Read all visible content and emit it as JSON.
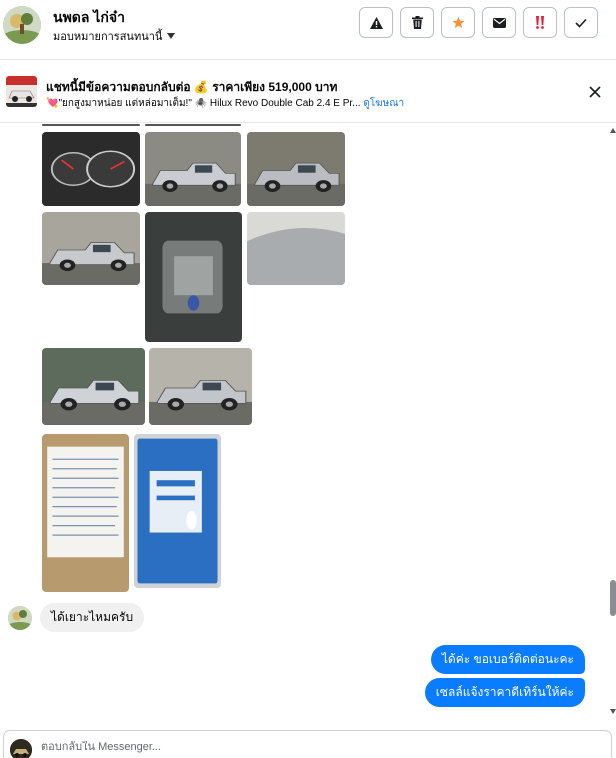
{
  "header": {
    "contact_name": "นพดล ไก่จ๋า",
    "assign_label": "มอบหมายการสนทนานี้",
    "actions": [
      {
        "name": "report-spam-button",
        "icon": "warning-icon"
      },
      {
        "name": "delete-button",
        "icon": "trash-icon"
      },
      {
        "name": "follow-up-button",
        "icon": "star-icon"
      },
      {
        "name": "mark-unread-button",
        "icon": "envelope-icon"
      },
      {
        "name": "priority-button",
        "icon": "double-exclamation-icon"
      },
      {
        "name": "mark-done-button",
        "icon": "checkmark-icon"
      }
    ],
    "colors": {
      "star": "#f7923b",
      "priority": "#e41e3f"
    }
  },
  "ad_banner": {
    "title": "แชทนี้มีข้อความตอบกลับต่อ 💰 ราคาเพียง 519,000 บาท",
    "subtitle": "💘\"ยกสูงมาหน่อย แต่หล่อมาเต็ม!\" 🕷️ Hilux Revo Double Cab 2.4 E Pr...",
    "view_ad_link": "ดูโฆษณา"
  },
  "messages": {
    "incoming": "ได้เยาะไหมครับ",
    "outgoing": [
      "ได้ค่ะ ขอเบอร์ติดต่อนะคะ",
      "เซลล์แจ้งราคาดีเทิร์นให้ค่ะ"
    ]
  },
  "reply": {
    "placeholder": "ตอบกลับใน Messenger..."
  },
  "theme": {
    "accent": "#0a7cff",
    "incoming_bubble": "#f0f0f0",
    "link": "#1877f2"
  }
}
